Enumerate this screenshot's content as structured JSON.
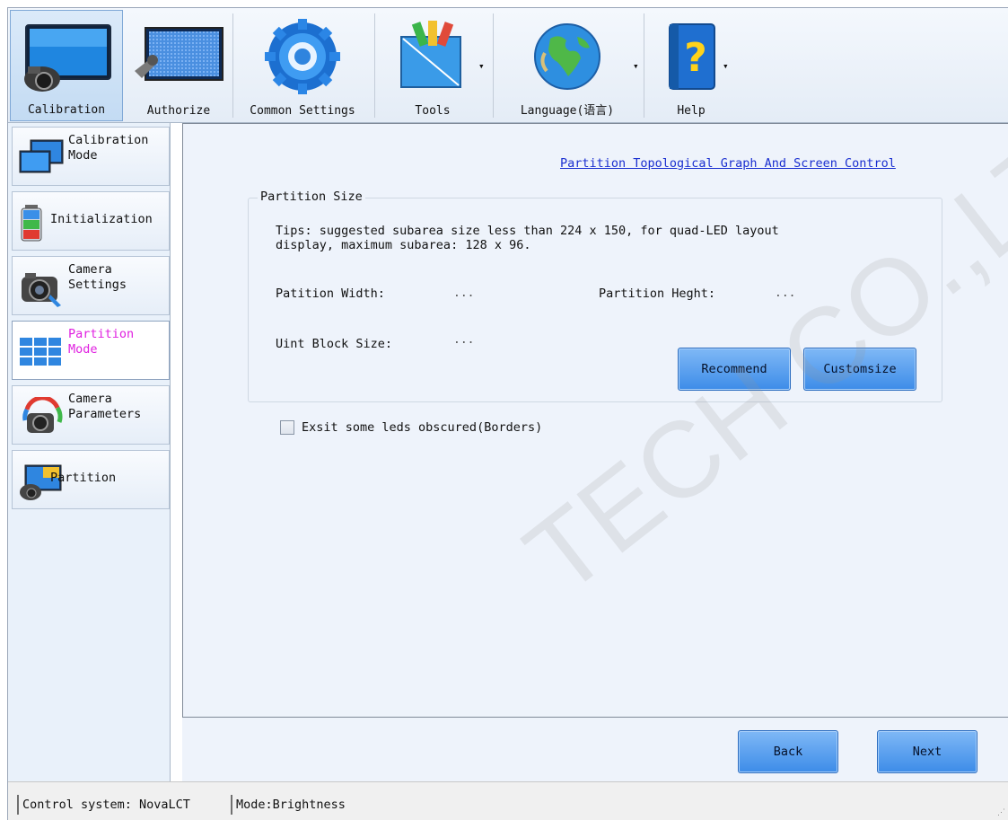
{
  "toolbar": {
    "items": [
      {
        "label": "Calibration",
        "icon": "calibration-icon",
        "active": true
      },
      {
        "label": "Authorize",
        "icon": "authorize-icon"
      },
      {
        "label": "Common Settings",
        "icon": "common-settings-gear-icon"
      },
      {
        "label": "Tools",
        "icon": "tools-icon",
        "dropdown": true
      },
      {
        "label": "Language(语言)",
        "icon": "globe-icon",
        "dropdown": true
      },
      {
        "label": "Help",
        "icon": "help-book-icon",
        "dropdown": true
      }
    ]
  },
  "sidebar": {
    "items": [
      {
        "label": "Calibration\nMode",
        "icon": "monitor-icon"
      },
      {
        "label": "Initialization",
        "icon": "battery-icon"
      },
      {
        "label": "Camera\nSettings",
        "icon": "camera-icon"
      },
      {
        "label": "Partition\nMode",
        "icon": "grid-icon",
        "active": true
      },
      {
        "label": "Camera\nParameters",
        "icon": "camera-refresh-icon"
      },
      {
        "label": "Partition",
        "icon": "partition-icon"
      }
    ]
  },
  "main": {
    "topology_link": "Partition Topological Graph And Screen Control",
    "group_title": "Partition Size",
    "tips": "Tips: suggested subarea size less than 224 x 150, for quad-LED layout\ndisplay, maximum subarea: 128 x 96.",
    "width_label": "Patition Width:",
    "width_value": "...",
    "height_label": "Partition Heght:",
    "height_value": "...",
    "block_label": "Uint Block Size:",
    "block_value": "...",
    "recommend_button": "Recommend",
    "customsize_button": "Customsize",
    "checkbox_label": "Exsit some leds obscured(Borders)",
    "checkbox_checked": false
  },
  "footer": {
    "back_button": "Back",
    "next_button": "Next"
  },
  "status": {
    "system": "Control system: NovaLCT",
    "mode": "Mode:Brightness"
  },
  "watermark": "TECH CO.,LTD",
  "colors": {
    "accent_blue": "#3d8ce8",
    "link": "#1a2fd0",
    "active_nav_text": "#e020e0",
    "panel_bg": "#eef3fb"
  }
}
